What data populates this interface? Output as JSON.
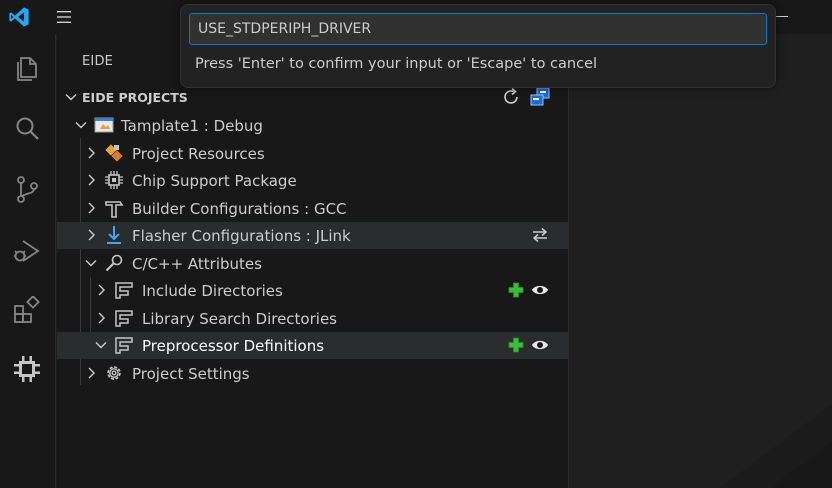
{
  "colors": {
    "accent": "#0078d4",
    "vscode_blue": "#23a9f2",
    "add_green": "#3dbb3d",
    "icon_gray": "#c5c5c5",
    "orange": "#e5a23a"
  },
  "quick_input": {
    "value": "USE_STDPERIPH_DRIVER",
    "message": "Press 'Enter' to confirm your input or 'Escape' to cancel"
  },
  "sidebar": {
    "title": "EIDE",
    "section_title": "EIDE PROJECTS",
    "section_actions": [
      "refresh-icon",
      "eide-projects-icon"
    ]
  },
  "tree": {
    "project": "Tamplate1 : Debug",
    "items": {
      "project_resources": "Project Resources",
      "chip_support": "Chip Support Package",
      "builder_config": "Builder Configurations : GCC",
      "flasher_config": "Flasher Configurations : JLink",
      "cpp_attributes": "C/C++ Attributes",
      "include_dirs": "Include Directories",
      "library_dirs": "Library Search Directories",
      "preprocessor_defs": "Preprocessor Definitions",
      "project_settings": "Project Settings"
    }
  }
}
